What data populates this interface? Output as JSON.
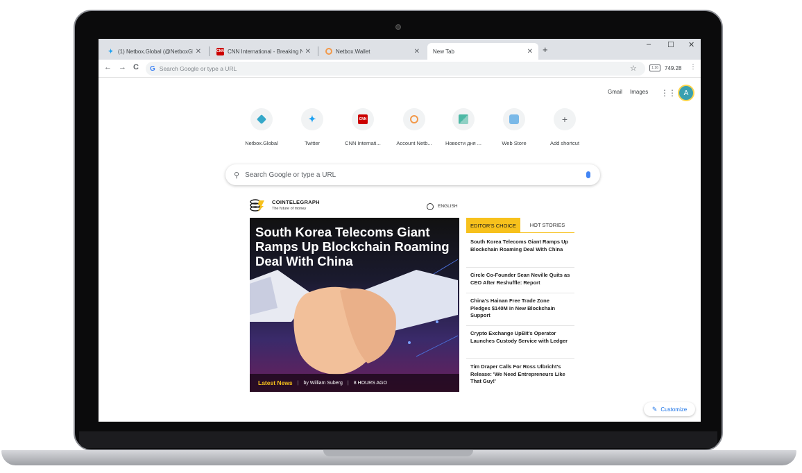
{
  "browser": {
    "tabs": [
      {
        "title": "(1) Netbox.Global (@NetboxGlo",
        "icon": "twitter-icon"
      },
      {
        "title": "CNN International - Breaking Ne",
        "icon": "cnn-icon"
      },
      {
        "title": "Netbox.Wallet",
        "icon": "netbox-icon"
      },
      {
        "title": "New Tab",
        "icon": "none",
        "active": true
      }
    ],
    "new_tab": "+",
    "window_controls": {
      "minimize": "–",
      "maximize": "☐",
      "close": "✕"
    },
    "nav": {
      "back": "←",
      "forward": "→",
      "reload": "C"
    },
    "omnibox": {
      "placeholder": "Search Google or type a URL",
      "g": "G"
    },
    "extension": {
      "label": "749.28",
      "badge": "1:16"
    },
    "star": "☆",
    "menu": "⋮"
  },
  "ntp": {
    "gmail": "Gmail",
    "images": "Images",
    "avatar_letter": "A",
    "shortcuts": [
      {
        "label": "Netbox.Global",
        "icon": "netbox-icon",
        "color": "#35a8c9"
      },
      {
        "label": "Twitter",
        "icon": "twitter-icon",
        "color": "#1da1f2"
      },
      {
        "label": "CNN Internati...",
        "icon": "cnn-icon",
        "color": "#cc0000"
      },
      {
        "label": "Account Netb...",
        "icon": "netbox-account-icon",
        "color": "#f2994a"
      },
      {
        "label": "Новости дня ...",
        "icon": "news-icon",
        "color": "#4cb8a5"
      },
      {
        "label": "Web Store",
        "icon": "web-store-icon",
        "color": "#7ab9e8"
      },
      {
        "label": "Add shortcut",
        "icon": "plus-icon",
        "color": "#5f6368"
      }
    ],
    "search_placeholder": "Search Google or type a URL",
    "customize": "Customize"
  },
  "widget": {
    "brand": "COINTELEGRAPH",
    "tagline": "The future of money",
    "language": "ENGLISH",
    "hero": {
      "title": "South Korea Telecoms Giant Ramps Up Blockchain Roaming Deal With China",
      "category": "Latest News",
      "author": "by William Suberg",
      "time": "8 HOURS AGO"
    },
    "tab_editor": "EDITOR'S CHOICE",
    "tab_hot": "HOT STORIES",
    "stories": [
      "South Korea Telecoms Giant Ramps Up Blockchain Roaming Deal With China",
      "Circle Co-Founder Sean Neville Quits as CEO After Reshuffle: Report",
      "China's Hainan Free Trade Zone Pledges $140M in New Blockchain Support",
      "Crypto Exchange UpBit's Operator Launches Custody Service with Ledger",
      "Tim Draper Calls For Ross Ulbricht's Release: 'We Need Entrepreneurs Like That Guy!'"
    ]
  },
  "colors": {
    "accent": "#f7c11c",
    "link": "#1a73e8",
    "tabstrip": "#dee1e6"
  }
}
